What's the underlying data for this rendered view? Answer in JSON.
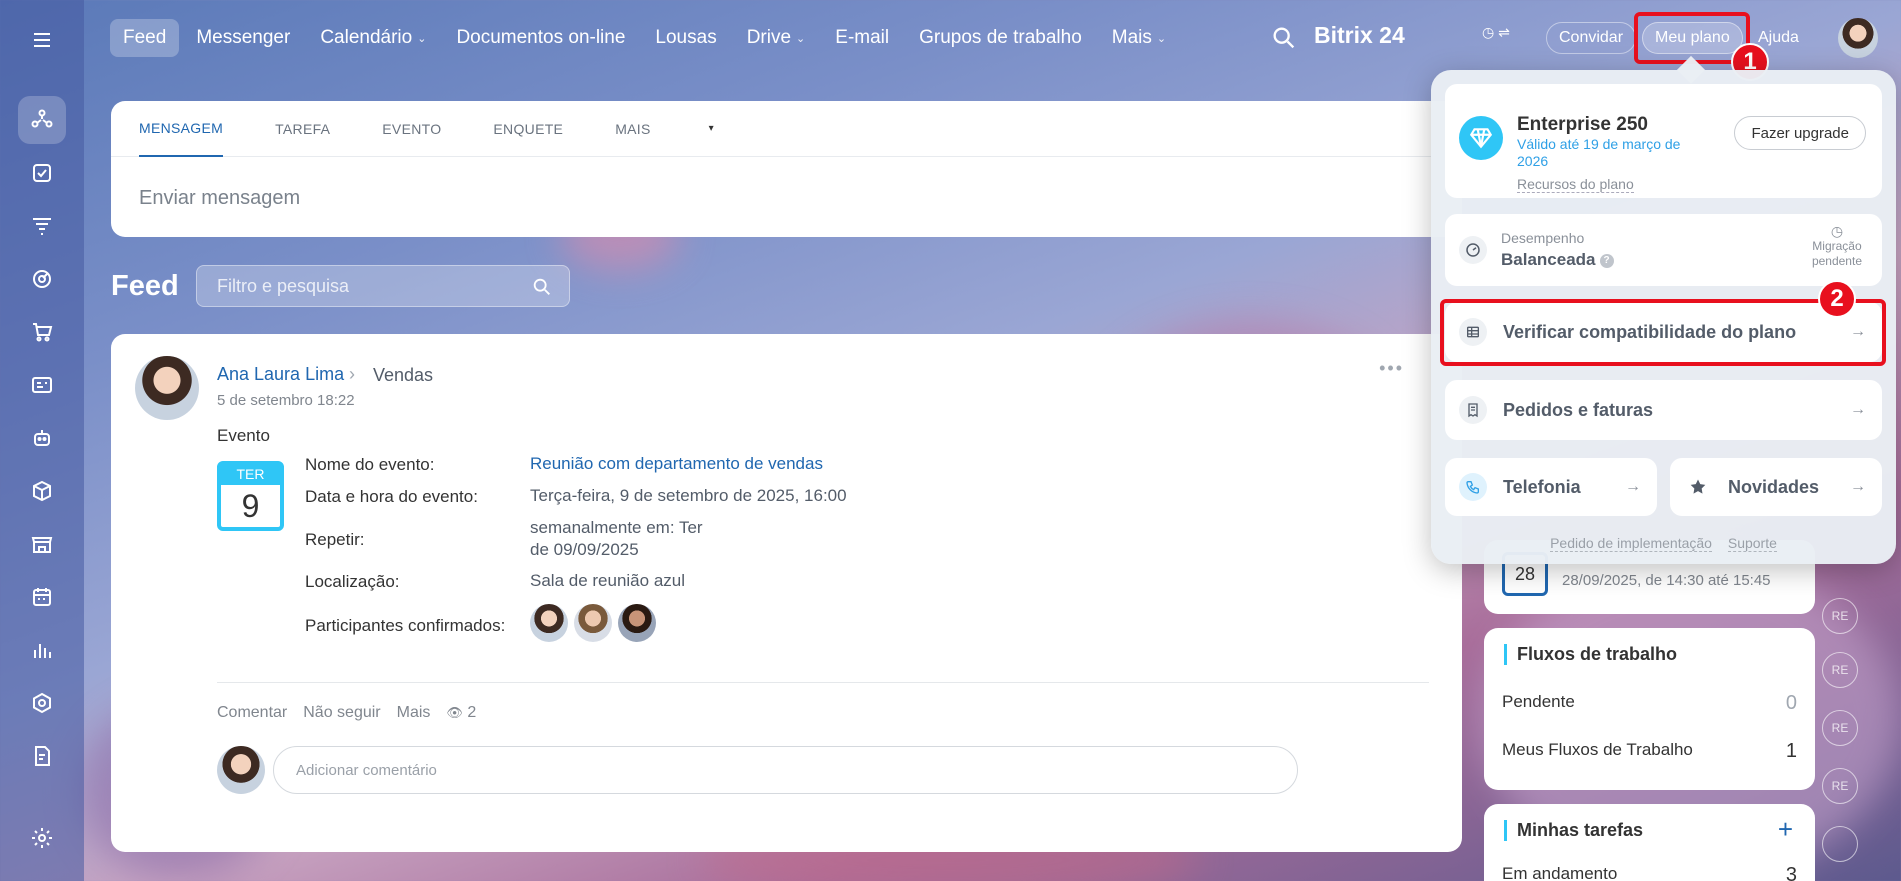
{
  "nav": {
    "items": [
      {
        "label": "Feed",
        "active": true,
        "chevron": false
      },
      {
        "label": "Messenger",
        "active": false,
        "chevron": false
      },
      {
        "label": "Calendário",
        "active": false,
        "chevron": true
      },
      {
        "label": "Documentos on-line",
        "active": false,
        "chevron": false
      },
      {
        "label": "Lousas",
        "active": false,
        "chevron": false
      },
      {
        "label": "Drive",
        "active": false,
        "chevron": true
      },
      {
        "label": "E-mail",
        "active": false,
        "chevron": false
      },
      {
        "label": "Grupos de trabalho",
        "active": false,
        "chevron": false
      },
      {
        "label": "Mais",
        "active": false,
        "chevron": true
      }
    ]
  },
  "header": {
    "brand": "Bitrix 24",
    "invite_label": "Convidar",
    "plan_label": "Meu plano",
    "help_label": "Ajuda"
  },
  "composer": {
    "tabs": [
      "MENSAGEM",
      "TAREFA",
      "EVENTO",
      "ENQUETE",
      "MAIS"
    ],
    "placeholder": "Enviar mensagem"
  },
  "feed": {
    "title": "Feed",
    "search_placeholder": "Filtro e pesquisa"
  },
  "post": {
    "author": "Ana Laura Lima",
    "group": "Vendas",
    "date": "5 de setembro 18:22",
    "type_label": "Evento",
    "calendar": {
      "weekday": "TER",
      "day": "9"
    },
    "rows": {
      "name_label": "Nome do evento:",
      "name_value": "Reunião com departamento de vendas",
      "datetime_label": "Data e hora do evento:",
      "datetime_value": "Terça-feira, 9 de setembro de 2025, 16:00",
      "repeat_label": "Repetir:",
      "repeat_value_1": "semanalmente em: Ter",
      "repeat_value_2": "de 09/09/2025",
      "location_label": "Localização:",
      "location_value": "Sala de reunião azul",
      "participants_label": "Participantes confirmados:"
    },
    "actions": {
      "comment": "Comentar",
      "unfollow": "Não seguir",
      "more": "Mais",
      "views": "2"
    },
    "comment_placeholder": "Adicionar comentário"
  },
  "widgets": {
    "event": {
      "day": "28",
      "time": "28/09/2025, de 14:30 até 15:45"
    },
    "flows": {
      "title": "Fluxos de trabalho",
      "pending_label": "Pendente",
      "pending_count": "0",
      "mine_label": "Meus Fluxos de Trabalho",
      "mine_count": "1"
    },
    "tasks": {
      "title": "Minhas tarefas",
      "ongoing_label": "Em andamento",
      "ongoing_count": "3"
    }
  },
  "side_circles": [
    "RE",
    "RE",
    "RE",
    "RE"
  ],
  "popup": {
    "plan_name": "Enterprise 250",
    "plan_valid": "Válido até 19 de março de 2026",
    "plan_resources": "Recursos do plano",
    "upgrade_label": "Fazer upgrade",
    "performance_label": "Desempenho",
    "performance_value": "Balanceada",
    "migration_label_1": "Migração",
    "migration_label_2": "pendente",
    "verify_label": "Verificar compatibilidade do plano",
    "orders_label": "Pedidos e faturas",
    "telephony_label": "Telefonia",
    "news_label": "Novidades",
    "footer_impl": "Pedido de implementação",
    "footer_support": "Suporte"
  },
  "annotations": [
    "1",
    "2"
  ],
  "colors": {
    "accent": "#2067b0",
    "highlight": "#e8101e",
    "calendar": "#2fc6f6"
  }
}
